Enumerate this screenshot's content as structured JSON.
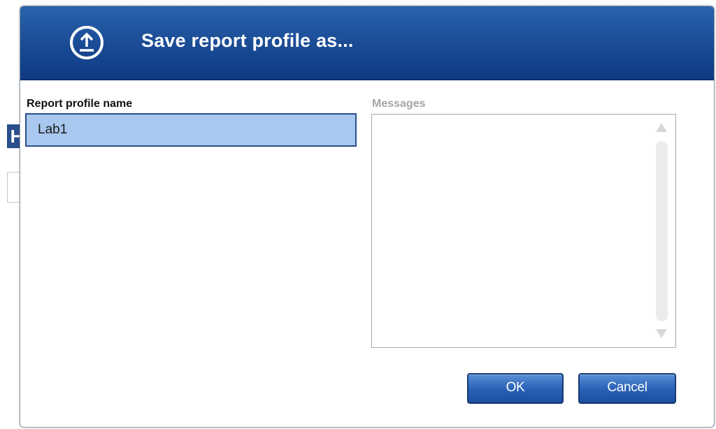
{
  "dialog": {
    "title": "Save report profile as...",
    "icon": "upload-icon"
  },
  "form": {
    "name_label": "Report profile name",
    "name_value": "Lab1",
    "messages_label": "Messages"
  },
  "buttons": {
    "ok_label": "OK",
    "cancel_label": "Cancel"
  },
  "background": {
    "marker_letter": "H"
  },
  "colors": {
    "title_bar": "#1a4a94",
    "input_highlight": "#a8c8f0",
    "button": "#2a63b8"
  }
}
